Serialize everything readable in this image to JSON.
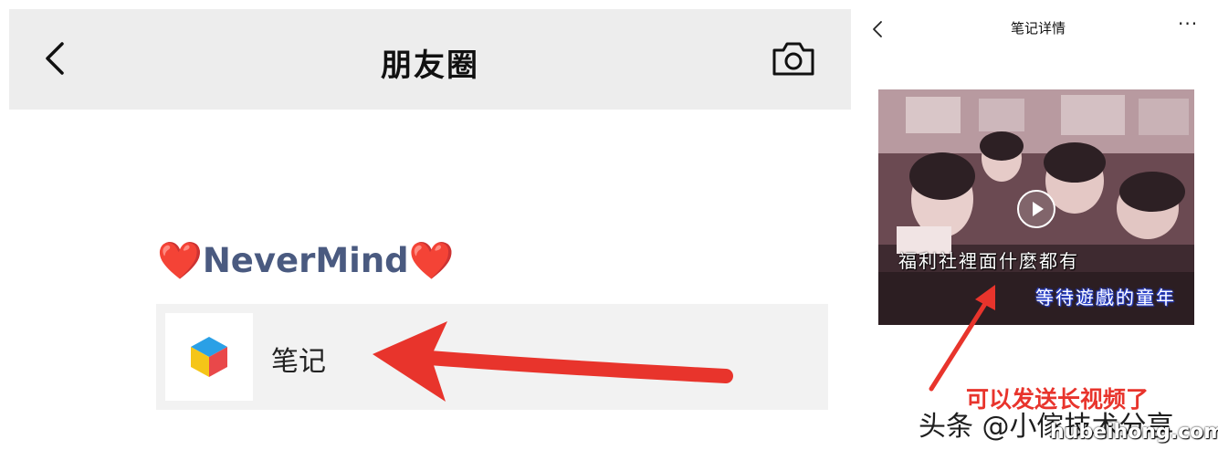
{
  "moments": {
    "title": "朋友圈",
    "user_name": "NeverMind",
    "heart_glyph": "❤️",
    "share": {
      "title": "笔记"
    }
  },
  "note_detail": {
    "title": "笔记详情",
    "more_glyph": "···",
    "video": {
      "subtitle_line1": "福利社裡面什麼都有",
      "subtitle_line2": "等待遊戲的童年"
    },
    "caption": "可以发送长视频了"
  },
  "watermark": {
    "text": "头条 @小傢技术分享",
    "site": "hubeihong.com"
  },
  "colors": {
    "arrow_red": "#e8342c",
    "nav_gray": "#ededed",
    "name_blue": "#4a5a80"
  },
  "icons": [
    "back-arrow-icon",
    "camera-icon",
    "note-app-icon",
    "more-icon",
    "play-icon"
  ]
}
